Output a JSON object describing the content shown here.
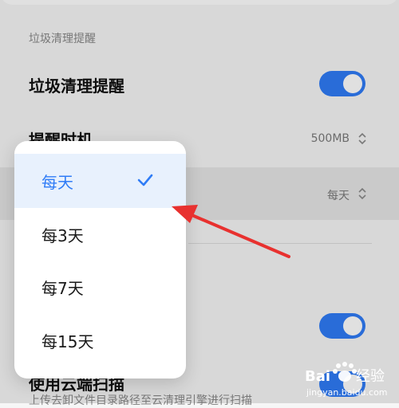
{
  "section": {
    "title": "垃圾清理提醒"
  },
  "rows": {
    "reminder": {
      "label": "垃圾清理提醒"
    },
    "timing": {
      "label": "提醒时机",
      "value": "500MB"
    },
    "frequency": {
      "value": "每天"
    },
    "cloud_scan": {
      "label": "使用云端扫描",
      "desc": "上传去卸文件目录路径至云清理引擎进行扫描"
    }
  },
  "menu": {
    "items": [
      {
        "label": "每天",
        "selected": true
      },
      {
        "label": "每3天",
        "selected": false
      },
      {
        "label": "每7天",
        "selected": false
      },
      {
        "label": "每15天",
        "selected": false
      }
    ]
  },
  "watermark": {
    "brand": "Bai",
    "brand2": "经验",
    "url": "jingyan.baidu.com"
  },
  "colors": {
    "accent": "#2f7cf6",
    "arrow": "#e8312f"
  }
}
